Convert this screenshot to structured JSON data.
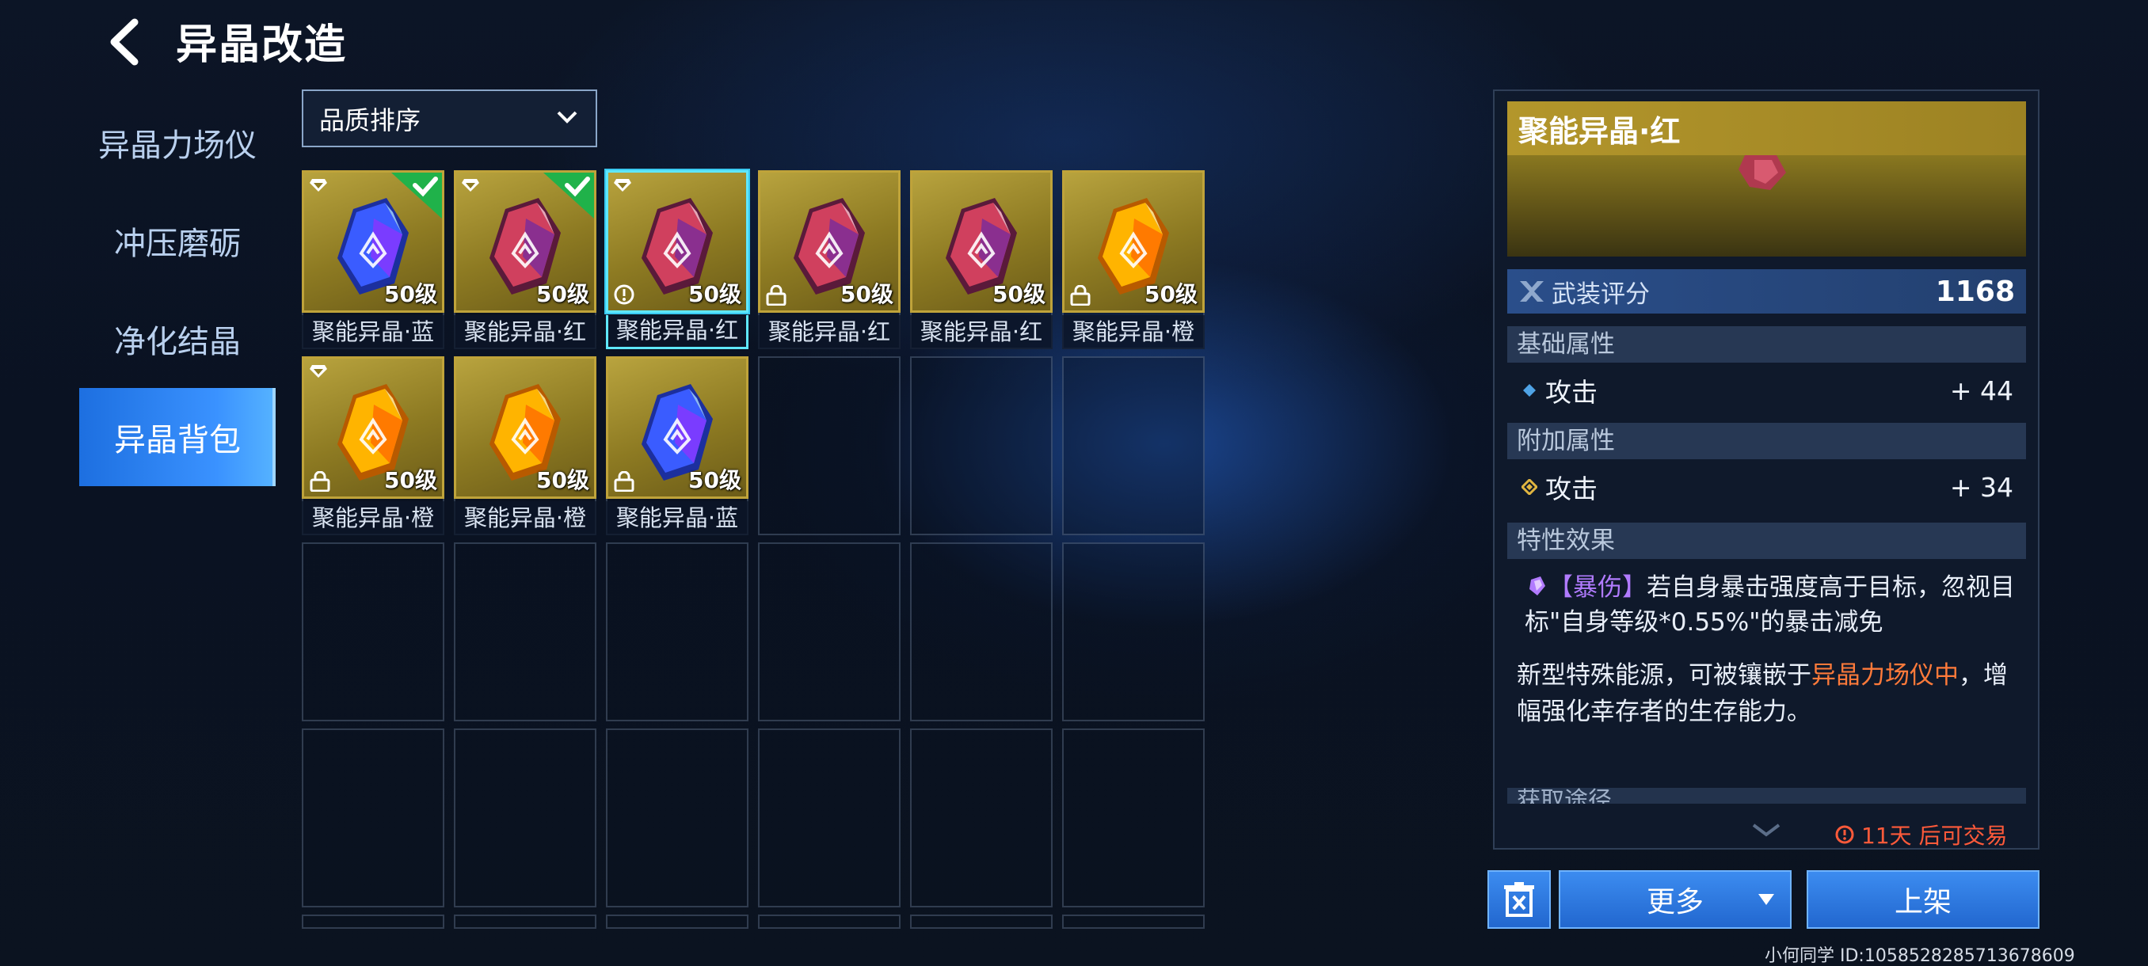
{
  "header": {
    "title": "异晶改造",
    "back_icon": "back-arrow-icon"
  },
  "nav": {
    "items": [
      {
        "label": "异晶力场仪",
        "active": false
      },
      {
        "label": "冲压磨砺",
        "active": false
      },
      {
        "label": "净化结晶",
        "active": false
      },
      {
        "label": "异晶背包",
        "active": true
      }
    ]
  },
  "sort": {
    "label": "品质排序",
    "icon": "chevron-down-icon"
  },
  "inventory": {
    "items": [
      {
        "name": "聚能异晶·蓝",
        "level": "50级",
        "color": "blue",
        "equipped": true,
        "locked": false,
        "marked": true,
        "selected": false
      },
      {
        "name": "聚能异晶·红",
        "level": "50级",
        "color": "red",
        "equipped": true,
        "locked": false,
        "marked": true,
        "selected": false
      },
      {
        "name": "聚能异晶·红",
        "level": "50级",
        "color": "red",
        "equipped": false,
        "locked": false,
        "marked": true,
        "warning": true,
        "selected": true
      },
      {
        "name": "聚能异晶·红",
        "level": "50级",
        "color": "red",
        "equipped": false,
        "locked": true,
        "marked": false,
        "selected": false
      },
      {
        "name": "聚能异晶·红",
        "level": "50级",
        "color": "red",
        "equipped": false,
        "locked": false,
        "marked": false,
        "selected": false
      },
      {
        "name": "聚能异晶·橙",
        "level": "50级",
        "color": "orange",
        "equipped": false,
        "locked": true,
        "marked": false,
        "selected": false
      },
      {
        "name": "聚能异晶·橙",
        "level": "50级",
        "color": "orange",
        "equipped": false,
        "locked": true,
        "marked": true,
        "selected": false
      },
      {
        "name": "聚能异晶·橙",
        "level": "50级",
        "color": "orange",
        "equipped": false,
        "locked": false,
        "marked": false,
        "selected": false
      },
      {
        "name": "聚能异晶·蓝",
        "level": "50级",
        "color": "blue",
        "equipped": false,
        "locked": true,
        "marked": false,
        "selected": false
      }
    ]
  },
  "detail": {
    "title": "聚能异晶·红",
    "score_label": "武装评分",
    "score_value": "1168",
    "base_section": "基础属性",
    "base_attr": {
      "label": "攻击",
      "value": "+ 44"
    },
    "extra_section": "附加属性",
    "extra_attr": {
      "label": "攻击",
      "value": "+ 34"
    },
    "trait_section": "特性效果",
    "trait_tag": "【暴伤】",
    "trait_text": "若自身暴击强度高于目标，忽视目标\"自身等级*0.55%\"的暴击减免",
    "desc_before": "新型特殊能源，可被镶嵌于",
    "desc_highlight": "异晶力场仪中",
    "desc_after": "，增幅强化幸存者的生存能力。",
    "source_section": "获取途径",
    "trade_note": "11天 后可交易"
  },
  "actions": {
    "more_label": "更多",
    "list_label": "上架",
    "delete_icon": "trash-icon"
  },
  "footer": {
    "user_id": "小何同学  ID:1058528285713678609"
  },
  "colors": {
    "accent": "#2f7ff0",
    "gold": "#b3962b",
    "warning": "#ff5a3a",
    "highlight": "#ff7a3a",
    "trait": "#b17bff"
  }
}
